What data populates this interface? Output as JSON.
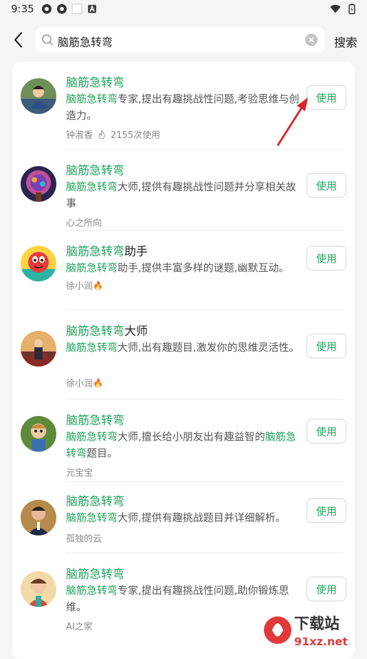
{
  "status": {
    "time": "9:35"
  },
  "search": {
    "query": "脑筋急转弯",
    "action": "搜索"
  },
  "items": [
    {
      "title_hl": "脑筋急转弯",
      "title_rest": "",
      "desc_hl": "脑筋急转弯",
      "desc_rest": "专家,提出有趣挑战性问题,考验思维与创造力。",
      "author": "钟淑香",
      "uses": "2155次使用",
      "button": "使用"
    },
    {
      "title_hl": "脑筋急转弯",
      "title_rest": "",
      "desc_hl": "脑筋急转弯",
      "desc_rest": "大师,提供有趣挑战性问题并分享相关故事",
      "author": "心之所向",
      "button": "使用"
    },
    {
      "title_hl": "脑筋急转弯",
      "title_rest": "助手",
      "desc_hl": "脑筋急转弯",
      "desc_rest": "助手,提供丰富多样的谜题,幽默互动。",
      "author": "徐小润",
      "fire": "🔥",
      "button": "使用"
    },
    {
      "title_hl": "脑筋急转弯",
      "title_rest": "大师",
      "desc_hl": "脑筋急转弯",
      "desc_rest": "大师,出有趣题目,激发你的思维灵活性。",
      "author": "徐小润",
      "fire": "🔥",
      "button": "使用"
    },
    {
      "title_hl": "脑筋急转弯",
      "title_rest": "",
      "desc_hl": "脑筋急转弯",
      "desc_mid": "大师,擅长给小朋友出有趣益智的",
      "desc_hl2": "脑筋急转弯",
      "desc_rest": "题目。",
      "author": "元宝宝",
      "button": "使用"
    },
    {
      "title_hl": "脑筋急转弯",
      "title_rest": "",
      "desc_hl": "脑筋急转弯",
      "desc_rest": "大师,提供有趣挑战题目并详细解析。",
      "author": "孤独的云",
      "button": "使用"
    },
    {
      "title_hl": "脑筋急转弯",
      "title_rest": "",
      "desc_hl": "脑筋急转弯",
      "desc_rest": "专家,提出有趣挑战性问题,助你锻炼思维。",
      "author": "AI之家",
      "button": "使用"
    }
  ],
  "watermark": {
    "text1": "下载站",
    "text2": "91xz.net"
  }
}
